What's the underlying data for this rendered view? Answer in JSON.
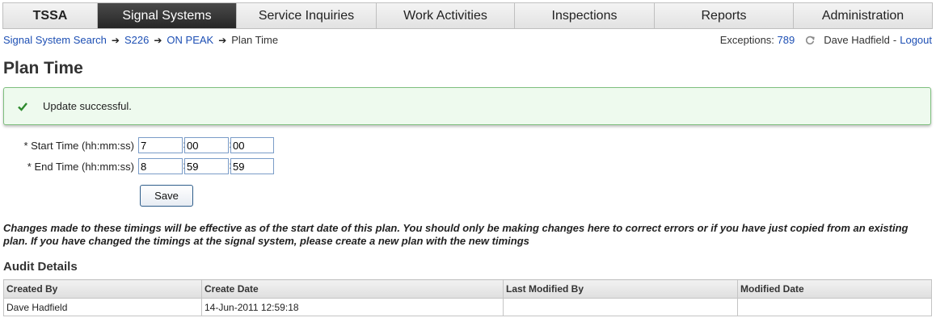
{
  "nav": {
    "tabs": [
      {
        "label": "TSSA",
        "active": false
      },
      {
        "label": "Signal Systems",
        "active": true
      },
      {
        "label": "Service Inquiries",
        "active": false
      },
      {
        "label": "Work Activities",
        "active": false
      },
      {
        "label": "Inspections",
        "active": false
      },
      {
        "label": "Reports",
        "active": false
      },
      {
        "label": "Administration",
        "active": false
      }
    ]
  },
  "breadcrumb": {
    "items": [
      "Signal System Search",
      "S226",
      "ON PEAK"
    ],
    "current": "Plan Time",
    "separator": "➔"
  },
  "userbar": {
    "exceptions_label": "Exceptions:",
    "exceptions_count": "789",
    "user_name": "Dave Hadfield",
    "separator": "-",
    "logout_label": "Logout"
  },
  "page": {
    "title": "Plan Time"
  },
  "message": {
    "text": "Update successful.",
    "icon": "checkmark-icon",
    "color": "#2d8a2d"
  },
  "form": {
    "start_time": {
      "label": "* Start Time (hh:mm:ss)",
      "hh": "7",
      "mm": "00",
      "ss": "00"
    },
    "end_time": {
      "label": "* End Time (hh:mm:ss)",
      "hh": "8",
      "mm": "59",
      "ss": "59"
    },
    "colon": ":",
    "save_label": "Save"
  },
  "note": "Changes made to these timings will be effective as of the start date of this plan. You should only be making changes here to correct errors or if you have just copied from an existing plan. If you have changed the timings at the signal system, please create a new plan with the new timings",
  "audit": {
    "title": "Audit Details",
    "columns": [
      "Created By",
      "Create Date",
      "Last Modified By",
      "Modified Date"
    ],
    "rows": [
      [
        "Dave Hadfield",
        "14-Jun-2011 12:59:18",
        "",
        ""
      ]
    ]
  },
  "colors": {
    "nav_active_bg": "#333333",
    "link": "#1d4fb4",
    "success_border": "#7fbf7f",
    "success_bg": "#eefaee"
  }
}
